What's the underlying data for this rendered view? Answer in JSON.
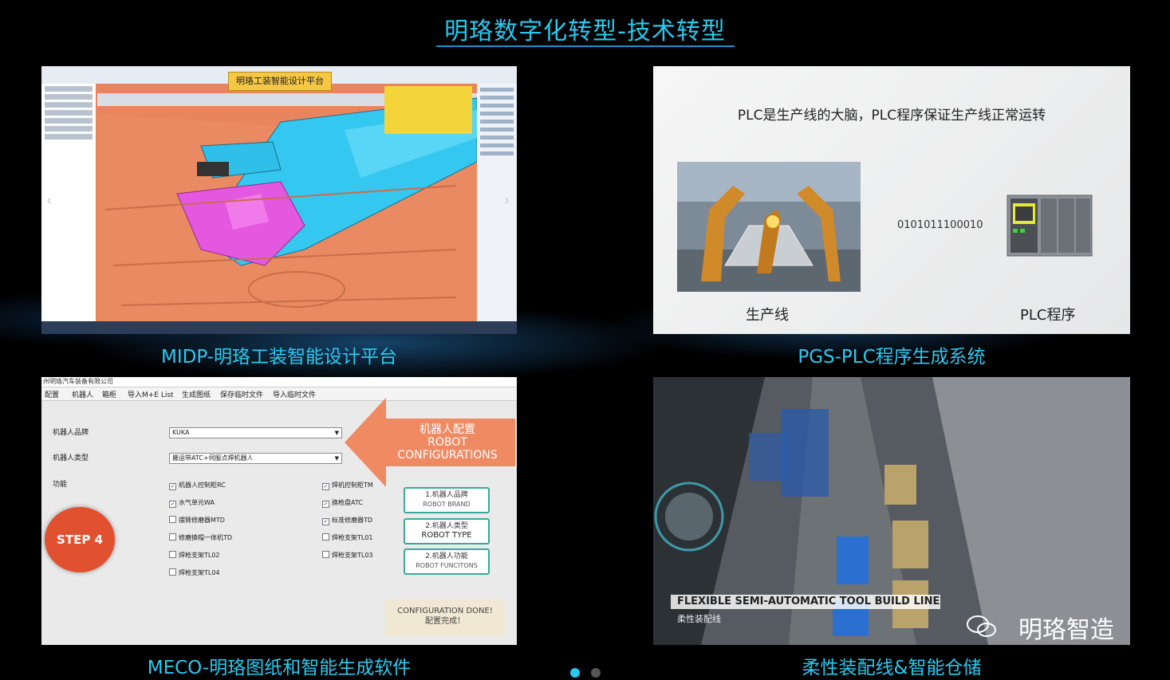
{
  "page": {
    "title": "明珞数字化转型-技术转型"
  },
  "captions": {
    "midp": "MIDP-明珞工装智能设计平台",
    "pgs": "PGS-PLC程序生成系统",
    "meco": "MECO-明珞图纸和智能生成软件",
    "flex": "柔性装配线&智能仓储"
  },
  "midp": {
    "badge": "明珞工装智能设计平台",
    "prev_glyph": "‹",
    "next_glyph": "›"
  },
  "pgs": {
    "tagline": "PLC是生产线的大脑，PLC程序保证生产线正常运转",
    "binary": "0101011100010",
    "label_line": "生产线",
    "label_plc": "PLC程序"
  },
  "meco": {
    "window_title": "州明珞汽车装备有限公司",
    "menu": [
      "配置",
      "机器人",
      "箱柜",
      "导入M+E List",
      "生成图纸",
      "保存临时文件",
      "导入临时文件"
    ],
    "brand_label": "机器人品牌",
    "brand_value": "KUKA",
    "type_label": "机器人类型",
    "type_value": "搬运带ATC+伺服点焊机器人",
    "function_label": "功能",
    "functions": [
      {
        "label": "机器人控制柜RC",
        "checked": true
      },
      {
        "label": "水气单元WA",
        "checked": true
      },
      {
        "label": "摆臂修磨器MTD",
        "checked": false
      },
      {
        "label": "修磨换帽一体机TD",
        "checked": false
      },
      {
        "label": "焊枪支架TL02",
        "checked": false
      },
      {
        "label": "焊枪支架TL04",
        "checked": false
      },
      {
        "label": "焊机控制柜TM",
        "checked": true
      },
      {
        "label": "换枪盘ATC",
        "checked": true
      },
      {
        "label": "标准修磨器TD",
        "checked": true
      },
      {
        "label": "焊枪支架TL01",
        "checked": false
      },
      {
        "label": "焊枪支架TL03",
        "checked": false
      }
    ],
    "arrow_cn": "机器人配置",
    "arrow_en1": "ROBOT",
    "arrow_en2": "CONFIGURATIONS",
    "step": "STEP 4",
    "boxes": [
      {
        "cn": "1.机器人品牌",
        "en": "ROBOT BRAND"
      },
      {
        "cn": "2.机器人类型",
        "en": "ROBOT TYPE"
      },
      {
        "cn": "2.机器人功能",
        "en": "ROBOT FUNCITONS"
      }
    ],
    "done_en": "CONFIGURATION DONE!",
    "done_cn": "配置完成！"
  },
  "flex": {
    "banner": "FLEXIBLE SEMI-AUTOMATIC TOOL BUILD LINE",
    "banner_sub": "柔性装配线",
    "watermark": "明珞智造"
  },
  "pager": {
    "active_index": 0,
    "count": 2
  },
  "colors": {
    "accent": "#2cc9ef",
    "step": "#e2512f",
    "arrow": "#ef8a63"
  }
}
